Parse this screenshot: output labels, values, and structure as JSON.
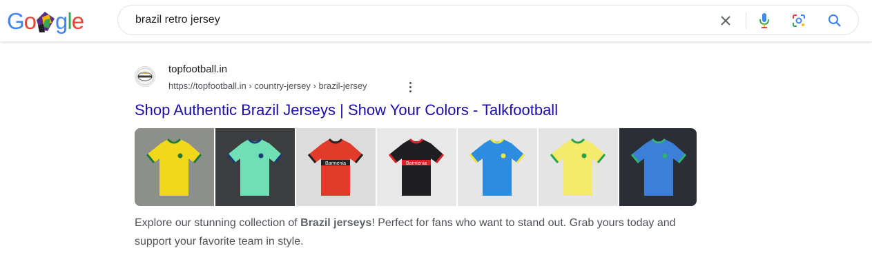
{
  "search": {
    "query": "brazil retro jersey"
  },
  "logo": {
    "letters": [
      "G",
      "o",
      "",
      "g",
      "l",
      "e"
    ],
    "colors": [
      "#ea4335",
      "#ea4335",
      "",
      "#ea4335",
      "#ea4335",
      "#ea4335"
    ]
  },
  "result": {
    "site_name": "topfootball.in",
    "url": "https://topfootball.in › country-jersey › brazil-jersey",
    "title": "Shop Authentic Brazil Jerseys | Show Your Colors - Talkfootball",
    "snippet_before": "Explore our stunning collection of ",
    "snippet_bold": "Brazil jerseys",
    "snippet_after": "! Perfect for fans who want to stand out. Grab yours today and support your favorite team in style."
  },
  "images": [
    {
      "name": "brazil-yellow-retro-jersey-image",
      "bg": "#8c8f8a",
      "shirt": "#f2d81b",
      "trim": "#1d7a3a"
    },
    {
      "name": "brazil-green-tracksuit-image",
      "bg": "#3b3d3f",
      "shirt": "#6fe0b5",
      "trim": "#1b3a78"
    },
    {
      "name": "leverkusen-red-jersey-image",
      "bg": "#dcdcdc",
      "shirt": "#e23b2a",
      "trim": "#222222",
      "text": "Barmenia"
    },
    {
      "name": "leverkusen-black-jersey-image",
      "bg": "#e8e8e8",
      "shirt": "#1f1f22",
      "trim": "#d8232a",
      "text": "Barmenia"
    },
    {
      "name": "brazil-blue-away-jersey-image",
      "bg": "#e6e6e6",
      "shirt": "#2b8ce0",
      "trim": "#f3e33a"
    },
    {
      "name": "brazil-yellow-home-jersey-image",
      "bg": "#e4e4e4",
      "shirt": "#f4ea6c",
      "trim": "#27a34a"
    },
    {
      "name": "brazil-blue-jersey-mannequin-image",
      "bg": "#2b2e35",
      "shirt": "#3c7fd8",
      "trim": "#2fb36e"
    }
  ],
  "colors": {
    "link": "#1a0dab",
    "mic_blue": "#4285f4",
    "mic_red": "#ea4335"
  }
}
